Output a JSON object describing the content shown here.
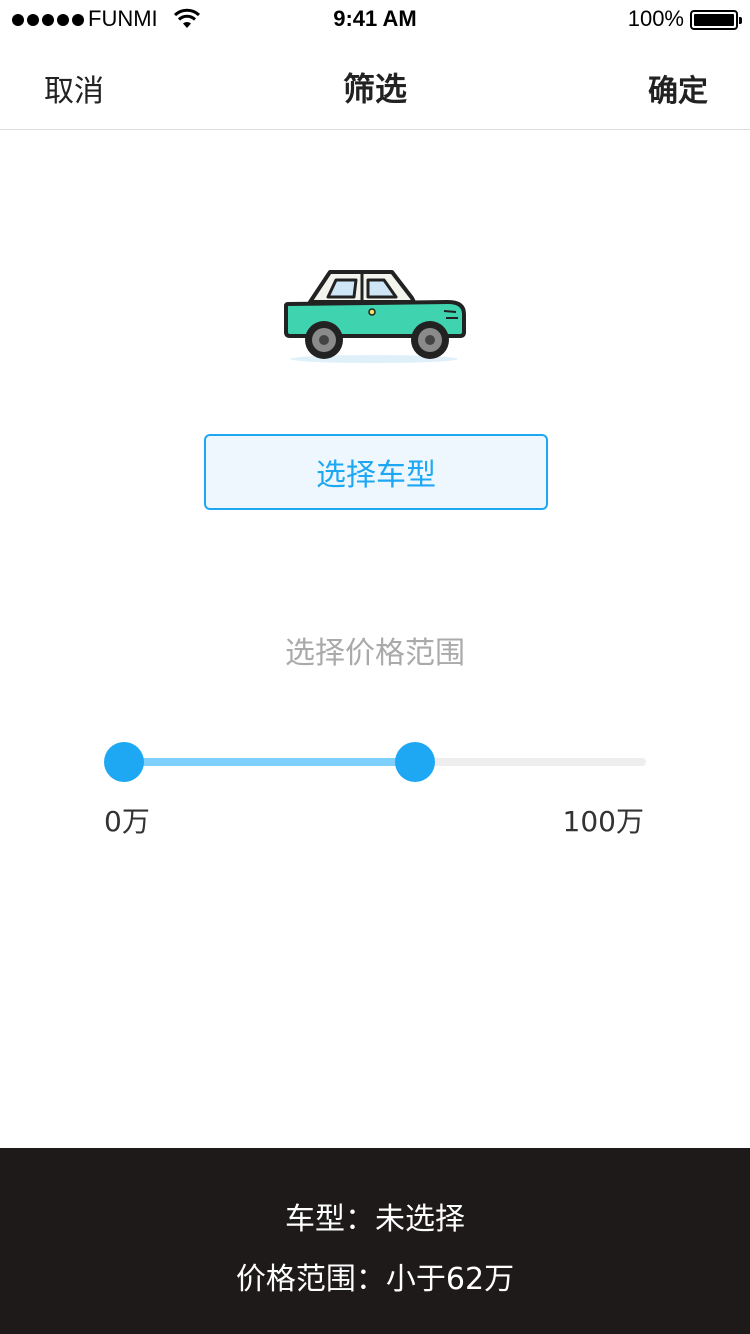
{
  "status_bar": {
    "carrier": "FUNMI",
    "time": "9:41 AM",
    "battery": "100%"
  },
  "nav": {
    "cancel": "取消",
    "title": "筛选",
    "confirm": "确定"
  },
  "car_select": {
    "button_label": "选择车型"
  },
  "price": {
    "label": "选择价格范围",
    "min_label": "0万",
    "max_label": "100万",
    "range_min": 0,
    "range_max": 100,
    "selected_low": 0,
    "selected_high": 58
  },
  "footer": {
    "car_type_line": "车型：未选择",
    "price_line": "价格范围：小于62万"
  },
  "colors": {
    "accent": "#1ea8f4",
    "accent_light": "#7dcffc",
    "footer_bg": "#1e1a19",
    "car_body": "#3fd3b0"
  }
}
